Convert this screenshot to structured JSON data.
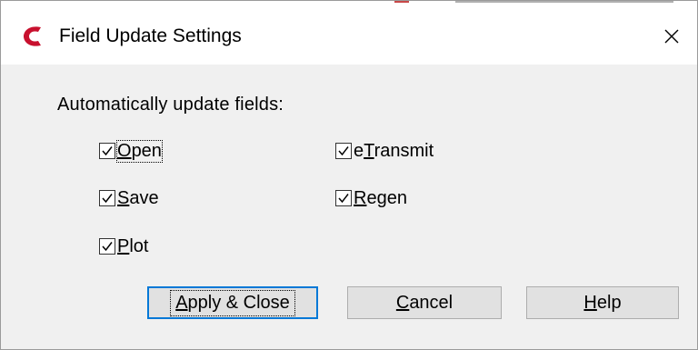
{
  "window": {
    "title": "Field Update Settings",
    "close_glyph": "✕",
    "app_icon": "autocad-c-icon",
    "accent_color": "#c8102e"
  },
  "section": {
    "label": "Automatically update fields:"
  },
  "checkboxes": [
    {
      "label": "Open",
      "mnemonic": "O",
      "rest": "pen",
      "prefix": "",
      "checked": true,
      "focused": true
    },
    {
      "label": "Save",
      "mnemonic": "S",
      "rest": "ave",
      "prefix": "",
      "checked": true,
      "focused": false
    },
    {
      "label": "Plot",
      "mnemonic": "P",
      "rest": "lot",
      "prefix": "",
      "checked": true,
      "focused": false
    },
    {
      "label": "eTransmit",
      "mnemonic": "T",
      "rest": "ransmit",
      "prefix": "e",
      "checked": true,
      "focused": false
    },
    {
      "label": "Regen",
      "mnemonic": "R",
      "rest": "egen",
      "prefix": "",
      "checked": true,
      "focused": false
    }
  ],
  "buttons": {
    "apply": {
      "label": "Apply & Close",
      "mnemonic": "A",
      "rest": "pply & Close"
    },
    "cancel": {
      "label": "Cancel",
      "mnemonic": "C",
      "rest": "ancel"
    },
    "help": {
      "label": "Help",
      "mnemonic": "H",
      "rest": "elp"
    }
  },
  "colors": {
    "default_button_border": "#0078d7",
    "dialog_background": "#f0f0f0"
  }
}
